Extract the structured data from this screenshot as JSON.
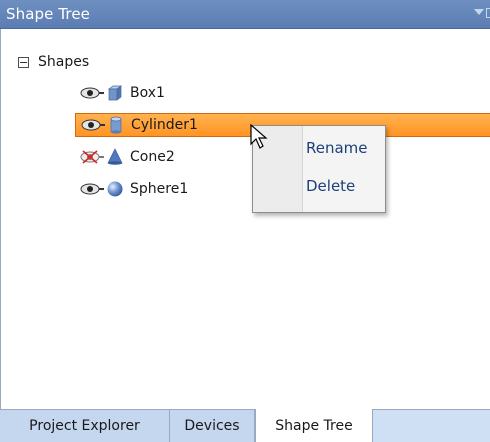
{
  "window": {
    "title": "Shape Tree"
  },
  "tree": {
    "root_label": "Shapes",
    "items": [
      {
        "label": "Box1",
        "visible": true,
        "shape": "box",
        "selected": false
      },
      {
        "label": "Cylinder1",
        "visible": true,
        "shape": "cylinder",
        "selected": true
      },
      {
        "label": "Cone2",
        "visible": false,
        "shape": "cone",
        "selected": false
      },
      {
        "label": "Sphere1",
        "visible": true,
        "shape": "sphere",
        "selected": false
      }
    ]
  },
  "context_menu": {
    "items": [
      "Rename",
      "Delete"
    ]
  },
  "tabs": [
    {
      "label": "Project Explorer",
      "active": false
    },
    {
      "label": "Devices",
      "active": false
    },
    {
      "label": "Shape Tree",
      "active": true
    }
  ],
  "colors": {
    "titlebar": "#5b7db3",
    "selection": "#ff9f33",
    "menu_text": "#1d3f7a",
    "tab_background": "#c4d7ef"
  },
  "icons": [
    "eye-icon",
    "eye-hidden-icon",
    "box-icon",
    "cylinder-icon",
    "cone-icon",
    "sphere-icon",
    "cursor-arrow-icon"
  ]
}
